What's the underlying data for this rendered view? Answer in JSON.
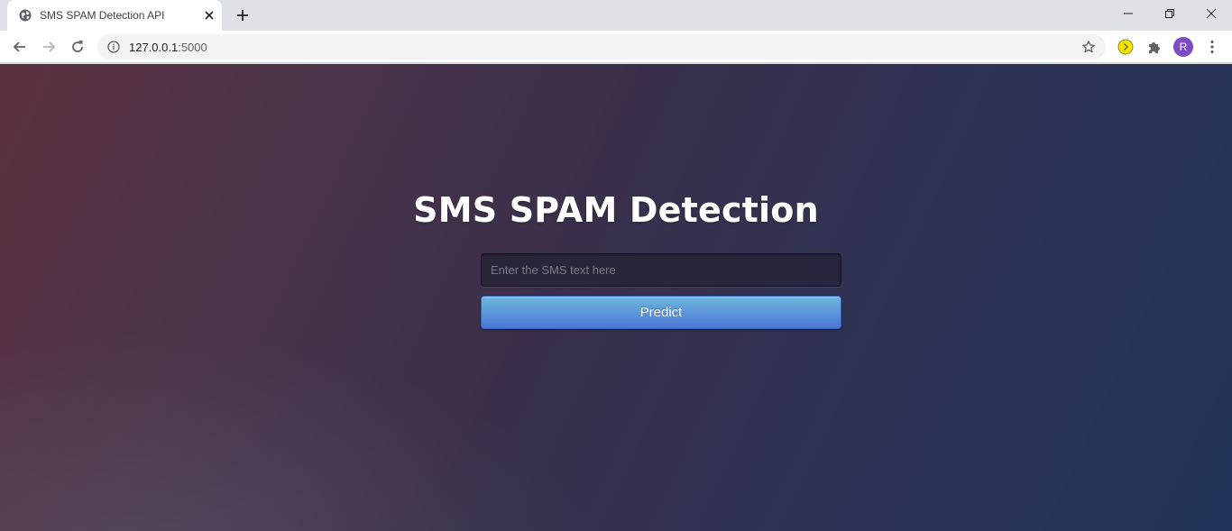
{
  "browser": {
    "tab_title": "SMS SPAM Detection API",
    "url_host": "127.0.0.1",
    "url_port": ":5000",
    "profile_initial": "R",
    "icons": [
      "globe-icon",
      "close-icon",
      "plus-icon",
      "minimize-icon",
      "restore-icon",
      "close-window-icon",
      "back-icon",
      "forward-icon",
      "reload-icon",
      "info-icon",
      "star-icon",
      "extension-icon",
      "puzzle-icon",
      "menu-icon"
    ]
  },
  "page": {
    "title": "SMS SPAM Detection",
    "input_placeholder": "Enter the SMS text here",
    "input_value": "",
    "button_label": "Predict"
  },
  "colors": {
    "button_top": "#6eb6de",
    "button_bottom": "#4a77d4",
    "background_left": "#5a3040",
    "background_right": "#213359",
    "avatar": "#7b4cc4"
  }
}
